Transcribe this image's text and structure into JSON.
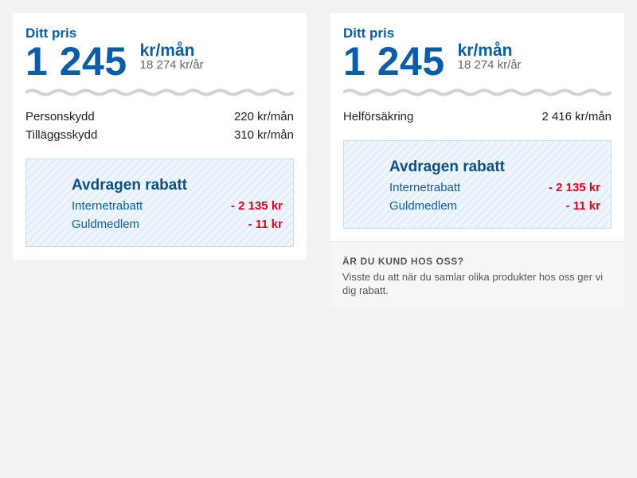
{
  "cards": [
    {
      "price_label": "Ditt pris",
      "price_monthly": "1 245",
      "price_unit": "kr/mån",
      "price_yearly": "18 274 kr/år",
      "line_items": [
        {
          "name": "Personskydd",
          "value": "220 kr/mån"
        },
        {
          "name": "Tilläggsskydd",
          "value": "310 kr/mån"
        }
      ],
      "discount": {
        "title": "Avdragen rabatt",
        "rows": [
          {
            "name": "Internetrabatt",
            "amount": "- 2 135 kr"
          },
          {
            "name": "Guldmedlem",
            "amount": "- 11 kr"
          }
        ]
      }
    },
    {
      "price_label": "Ditt pris",
      "price_monthly": "1 245",
      "price_unit": "kr/mån",
      "price_yearly": "18 274 kr/år",
      "line_items": [
        {
          "name": "Helförsäkring",
          "value": "2 416 kr/mån"
        }
      ],
      "discount": {
        "title": "Avdragen rabatt",
        "rows": [
          {
            "name": "Internetrabatt",
            "amount": "- 2 135 kr"
          },
          {
            "name": "Guldmedlem",
            "amount": "- 11 kr"
          }
        ]
      },
      "note": {
        "heading": "ÄR DU KUND HOS OSS?",
        "text": "Visste du att när du samlar olika produkter hos oss ger vi dig rabatt."
      }
    }
  ],
  "colors": {
    "brand_blue": "#0a5ea8",
    "discount_red": "#e0001b",
    "page_background": "#f2f2f2"
  }
}
